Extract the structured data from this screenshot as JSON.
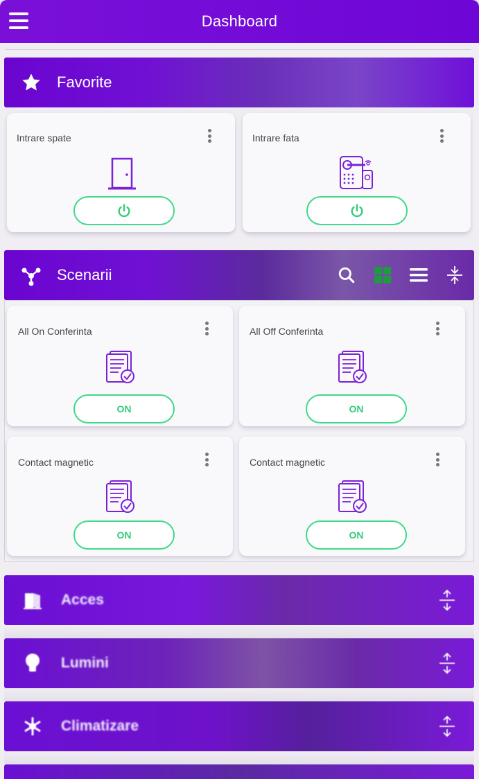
{
  "app": {
    "title": "Dashboard"
  },
  "colors": {
    "brand": "#6e06d6",
    "accent_green": "#3fd98a",
    "icon_purple": "#7b22d6"
  },
  "favorite": {
    "title": "Favorite",
    "icon": "star-icon",
    "cards": [
      {
        "title": "Intrare spate",
        "icon": "door-icon",
        "control": "power-icon"
      },
      {
        "title": "Intrare fata",
        "icon": "smart-lock-icon",
        "control": "power-icon"
      }
    ]
  },
  "scenarii": {
    "title": "Scenarii",
    "icon": "scene-network-icon",
    "tools": [
      "search-icon",
      "grid-view-icon",
      "list-view-icon",
      "collapse-icon"
    ],
    "cards": [
      {
        "title": "All On Conferinta",
        "button": "ON"
      },
      {
        "title": "All Off Conferinta",
        "button": "ON"
      },
      {
        "title": "Contact magnetic",
        "button": "ON"
      },
      {
        "title": "Contact magnetic",
        "button": "ON"
      }
    ]
  },
  "collapsed_sections": [
    {
      "title": "Acces",
      "icon": "door-open-icon"
    },
    {
      "title": "Lumini",
      "icon": "bulb-icon"
    },
    {
      "title": "Climatizare",
      "icon": "snowflake-icon"
    }
  ]
}
